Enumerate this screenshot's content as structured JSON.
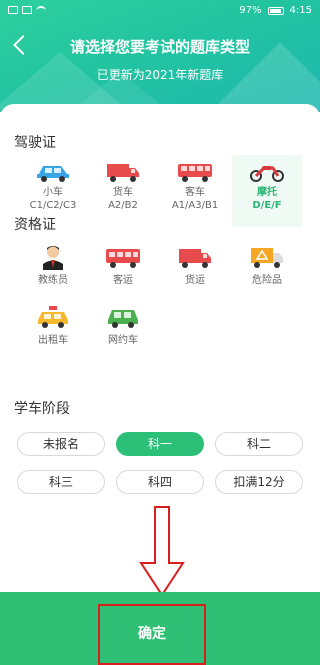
{
  "status": {
    "battery": "97%",
    "time": "4:15"
  },
  "header": {
    "title": "请选择您要考试的题库类型",
    "subtitle": "已更新为2021年新题库"
  },
  "license": {
    "title": "驾驶证",
    "items": [
      {
        "label": "小车",
        "sub": "C1/C2/C3",
        "icon": "car-icon",
        "selected": false
      },
      {
        "label": "货车",
        "sub": "A2/B2",
        "icon": "truck-icon",
        "selected": false
      },
      {
        "label": "客车",
        "sub": "A1/A3/B1",
        "icon": "bus-icon",
        "selected": false
      },
      {
        "label": "摩托",
        "sub": "D/E/F",
        "icon": "motorcycle-icon",
        "selected": true
      }
    ]
  },
  "qualification": {
    "title": "资格证",
    "items": [
      {
        "label": "教练员",
        "icon": "instructor-icon"
      },
      {
        "label": "客运",
        "icon": "passenger-bus-icon"
      },
      {
        "label": "货运",
        "icon": "freight-truck-icon"
      },
      {
        "label": "危险品",
        "icon": "hazmat-truck-icon"
      },
      {
        "label": "出租车",
        "icon": "taxi-icon"
      },
      {
        "label": "网约车",
        "icon": "ride-hailing-car-icon"
      }
    ]
  },
  "stage": {
    "title": "学车阶段",
    "options": [
      {
        "label": "未报名",
        "active": false
      },
      {
        "label": "科一",
        "active": true
      },
      {
        "label": "科二",
        "active": false
      },
      {
        "label": "科三",
        "active": false
      },
      {
        "label": "科四",
        "active": false
      },
      {
        "label": "扣满12分",
        "active": false
      }
    ]
  },
  "confirm": {
    "label": "确定"
  },
  "colors": {
    "accent": "#2cbf77",
    "header": "#22c4a0",
    "highlight": "#d81e1e"
  }
}
